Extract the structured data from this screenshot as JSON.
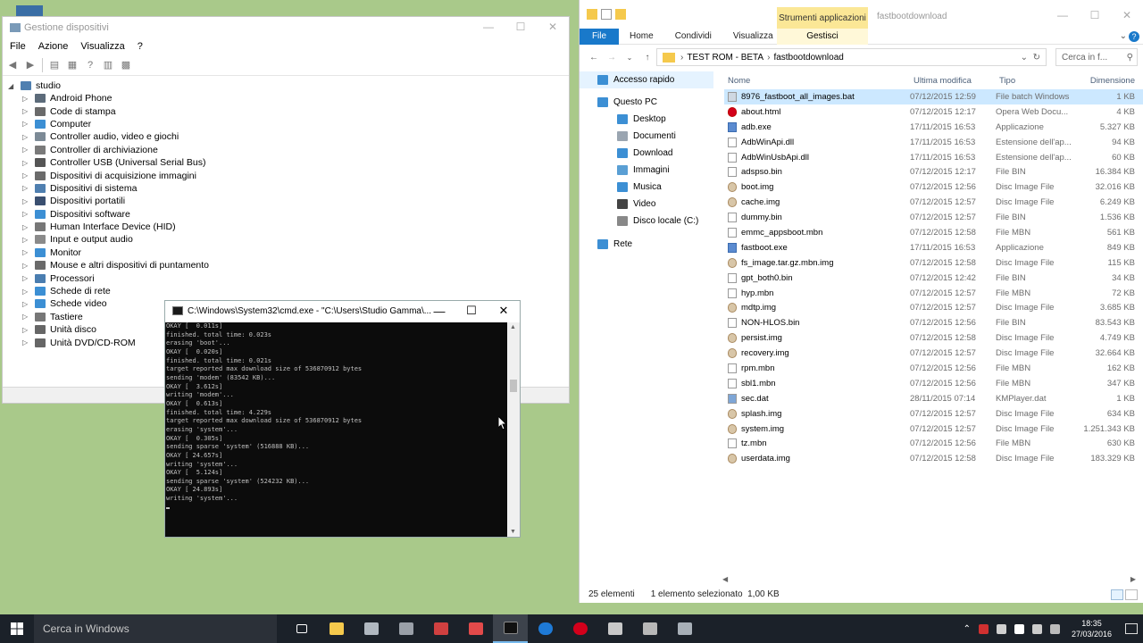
{
  "device_manager": {
    "title": "Gestione dispositivi",
    "menu": [
      "File",
      "Azione",
      "Visualizza",
      "?"
    ],
    "root": "studio",
    "items": [
      {
        "label": "Android Phone",
        "color": "#5c6b7a"
      },
      {
        "label": "Code di stampa",
        "color": "#6a6a6a"
      },
      {
        "label": "Computer",
        "color": "#3c8fd4"
      },
      {
        "label": "Controller audio, video e giochi",
        "color": "#7c8a96"
      },
      {
        "label": "Controller di archiviazione",
        "color": "#7a7a7a"
      },
      {
        "label": "Controller USB (Universal Serial Bus)",
        "color": "#555555"
      },
      {
        "label": "Dispositivi di acquisizione immagini",
        "color": "#6b6b6b"
      },
      {
        "label": "Dispositivi di sistema",
        "color": "#4f7fb0"
      },
      {
        "label": "Dispositivi portatili",
        "color": "#3a4f70"
      },
      {
        "label": "Dispositivi software",
        "color": "#3c8fd4"
      },
      {
        "label": "Human Interface Device (HID)",
        "color": "#777777"
      },
      {
        "label": "Input e output audio",
        "color": "#8a8a8a"
      },
      {
        "label": "Monitor",
        "color": "#3c8fd4"
      },
      {
        "label": "Mouse e altri dispositivi di puntamento",
        "color": "#6a6a6a"
      },
      {
        "label": "Processori",
        "color": "#4a7db0"
      },
      {
        "label": "Schede di rete",
        "color": "#3c8fd4"
      },
      {
        "label": "Schede video",
        "color": "#3c8fd4"
      },
      {
        "label": "Tastiere",
        "color": "#777777"
      },
      {
        "label": "Unità disco",
        "color": "#666666"
      },
      {
        "label": "Unità DVD/CD-ROM",
        "color": "#666666"
      }
    ]
  },
  "cmd": {
    "title": "C:\\Windows\\System32\\cmd.exe - \"C:\\Users\\Studio Gamma\\...",
    "lines": [
      "OKAY [  0.011s]",
      "finished. total time: 0.023s",
      "erasing 'boot'...",
      "OKAY [  0.020s]",
      "finished. total time: 0.021s",
      "target reported max download size of 536870912 bytes",
      "sending 'modem' (83542 KB)...",
      "OKAY [  3.612s]",
      "writing 'modem'...",
      "OKAY [  0.613s]",
      "finished. total time: 4.229s",
      "target reported max download size of 536870912 bytes",
      "erasing 'system'...",
      "OKAY [  0.305s]",
      "sending sparse 'system' (516888 KB)...",
      "OKAY [ 24.657s]",
      "writing 'system'...",
      "OKAY [  5.124s]",
      "sending sparse 'system' (524232 KB)...",
      "OKAY [ 24.893s]",
      "writing 'system'..."
    ]
  },
  "explorer": {
    "contextual_tab": "Strumenti applicazioni",
    "window_title": "fastbootdownload",
    "ribbon_tabs": [
      "File",
      "Home",
      "Condividi",
      "Visualizza"
    ],
    "gestisci": "Gestisci",
    "path": [
      "TEST ROM - BETA",
      "fastbootdownload"
    ],
    "search_placeholder": "Cerca in f...",
    "nav": [
      {
        "label": "Accesso rapido",
        "level": 0,
        "color": "#3c8fd4",
        "selected": true
      },
      {
        "label": "Questo PC",
        "level": 0,
        "color": "#3c8fd4"
      },
      {
        "label": "Desktop",
        "level": 1,
        "color": "#3c8fd4"
      },
      {
        "label": "Documenti",
        "level": 1,
        "color": "#9aa5b1"
      },
      {
        "label": "Download",
        "level": 1,
        "color": "#3c8fd4"
      },
      {
        "label": "Immagini",
        "level": 1,
        "color": "#5a9fd4"
      },
      {
        "label": "Musica",
        "level": 1,
        "color": "#3c8fd4"
      },
      {
        "label": "Video",
        "level": 1,
        "color": "#444444"
      },
      {
        "label": "Disco locale (C:)",
        "level": 1,
        "color": "#888888"
      },
      {
        "label": "Rete",
        "level": 0,
        "color": "#3c8fd4"
      }
    ],
    "columns": {
      "name": "Nome",
      "date": "Ultima modifica",
      "type": "Tipo",
      "size": "Dimensione"
    },
    "files": [
      {
        "name": "8976_fastboot_all_images.bat",
        "date": "07/12/2015 12:59",
        "type": "File batch Windows",
        "size": "1 KB",
        "icon": "bat"
      },
      {
        "name": "about.html",
        "date": "07/12/2015 12:17",
        "type": "Opera Web Docu...",
        "size": "4 KB",
        "icon": "html"
      },
      {
        "name": "adb.exe",
        "date": "17/11/2015 16:53",
        "type": "Applicazione",
        "size": "5.327 KB",
        "icon": "exe"
      },
      {
        "name": "AdbWinApi.dll",
        "date": "17/11/2015 16:53",
        "type": "Estensione dell'ap...",
        "size": "94 KB",
        "icon": "file"
      },
      {
        "name": "AdbWinUsbApi.dll",
        "date": "17/11/2015 16:53",
        "type": "Estensione dell'ap...",
        "size": "60 KB",
        "icon": "file"
      },
      {
        "name": "adspso.bin",
        "date": "07/12/2015 12:17",
        "type": "File BIN",
        "size": "16.384 KB",
        "icon": "file"
      },
      {
        "name": "boot.img",
        "date": "07/12/2015 12:56",
        "type": "Disc Image File",
        "size": "32.016 KB",
        "icon": "img"
      },
      {
        "name": "cache.img",
        "date": "07/12/2015 12:57",
        "type": "Disc Image File",
        "size": "6.249 KB",
        "icon": "img"
      },
      {
        "name": "dummy.bin",
        "date": "07/12/2015 12:57",
        "type": "File BIN",
        "size": "1.536 KB",
        "icon": "file"
      },
      {
        "name": "emmc_appsboot.mbn",
        "date": "07/12/2015 12:58",
        "type": "File MBN",
        "size": "561 KB",
        "icon": "file"
      },
      {
        "name": "fastboot.exe",
        "date": "17/11/2015 16:53",
        "type": "Applicazione",
        "size": "849 KB",
        "icon": "exe"
      },
      {
        "name": "fs_image.tar.gz.mbn.img",
        "date": "07/12/2015 12:58",
        "type": "Disc Image File",
        "size": "115 KB",
        "icon": "img"
      },
      {
        "name": "gpt_both0.bin",
        "date": "07/12/2015 12:42",
        "type": "File BIN",
        "size": "34 KB",
        "icon": "file"
      },
      {
        "name": "hyp.mbn",
        "date": "07/12/2015 12:57",
        "type": "File MBN",
        "size": "72 KB",
        "icon": "file"
      },
      {
        "name": "mdtp.img",
        "date": "07/12/2015 12:57",
        "type": "Disc Image File",
        "size": "3.685 KB",
        "icon": "img"
      },
      {
        "name": "NON-HLOS.bin",
        "date": "07/12/2015 12:56",
        "type": "File BIN",
        "size": "83.543 KB",
        "icon": "file"
      },
      {
        "name": "persist.img",
        "date": "07/12/2015 12:58",
        "type": "Disc Image File",
        "size": "4.749 KB",
        "icon": "img"
      },
      {
        "name": "recovery.img",
        "date": "07/12/2015 12:57",
        "type": "Disc Image File",
        "size": "32.664 KB",
        "icon": "img"
      },
      {
        "name": "rpm.mbn",
        "date": "07/12/2015 12:56",
        "type": "File MBN",
        "size": "162 KB",
        "icon": "file"
      },
      {
        "name": "sbl1.mbn",
        "date": "07/12/2015 12:56",
        "type": "File MBN",
        "size": "347 KB",
        "icon": "file"
      },
      {
        "name": "sec.dat",
        "date": "28/11/2015 07:14",
        "type": "KMPlayer.dat",
        "size": "1 KB",
        "icon": "dat"
      },
      {
        "name": "splash.img",
        "date": "07/12/2015 12:57",
        "type": "Disc Image File",
        "size": "634 KB",
        "icon": "img"
      },
      {
        "name": "system.img",
        "date": "07/12/2015 12:57",
        "type": "Disc Image File",
        "size": "1.251.343 KB",
        "icon": "img"
      },
      {
        "name": "tz.mbn",
        "date": "07/12/2015 12:56",
        "type": "File MBN",
        "size": "630 KB",
        "icon": "file"
      },
      {
        "name": "userdata.img",
        "date": "07/12/2015 12:58",
        "type": "Disc Image File",
        "size": "183.329 KB",
        "icon": "img"
      }
    ],
    "status": {
      "count": "25 elementi",
      "selection": "1 elemento selezionato",
      "size": "1,00 KB"
    }
  },
  "taskbar": {
    "search_placeholder": "Cerca in Windows",
    "apps": [
      {
        "name": "task-view",
        "color": "#ffffff"
      },
      {
        "name": "file-explorer",
        "color": "#f5c94c"
      },
      {
        "name": "app-gear",
        "color": "#b0b8c0"
      },
      {
        "name": "app-settings",
        "color": "#9aa0a8"
      },
      {
        "name": "app-tools",
        "color": "#d04040"
      },
      {
        "name": "mail",
        "color": "#e24a4a"
      },
      {
        "name": "cmd",
        "color": "#111111",
        "active": true
      },
      {
        "name": "edge",
        "color": "#1e7ad6"
      },
      {
        "name": "opera",
        "color": "#d3001b"
      },
      {
        "name": "app-8",
        "color": "#c8c8c8"
      },
      {
        "name": "app-9",
        "color": "#b8b8b8"
      },
      {
        "name": "app-10",
        "color": "#a8b0b8"
      }
    ],
    "time": "18:35",
    "date": "27/03/2016"
  }
}
